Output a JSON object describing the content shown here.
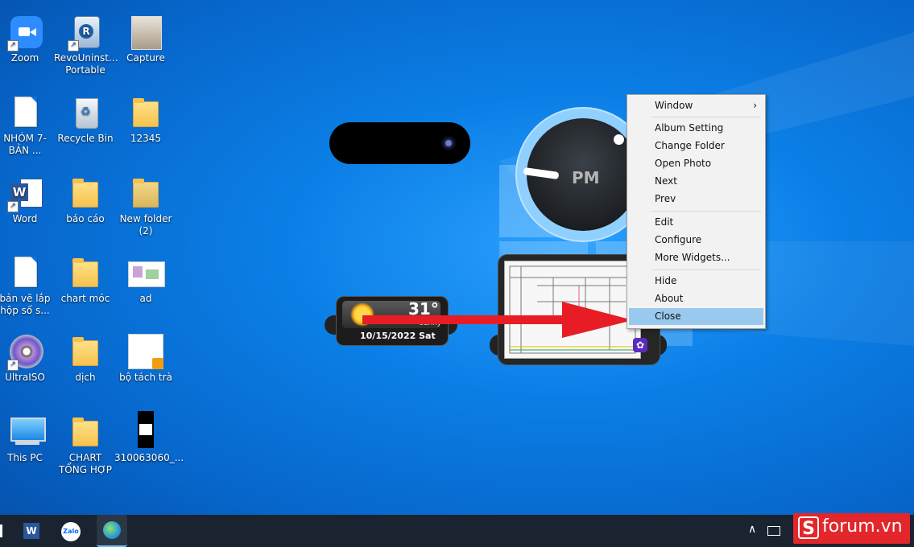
{
  "desktop": {
    "icons": [
      {
        "label": "Zoom"
      },
      {
        "label": "RevoUninst… Portable"
      },
      {
        "label": "Capture"
      },
      {
        "label": "NHÓM 7-BẢN ..."
      },
      {
        "label": "Recycle Bin"
      },
      {
        "label": "12345"
      },
      {
        "label": "Word"
      },
      {
        "label": "báo cáo"
      },
      {
        "label": "New folder (2)"
      },
      {
        "label": "bản vẽ lắp hộp số s..."
      },
      {
        "label": "chart móc"
      },
      {
        "label": "ad"
      },
      {
        "label": "UltraISO"
      },
      {
        "label": "dịch"
      },
      {
        "label": "bộ tách trà"
      },
      {
        "label": "This PC"
      },
      {
        "label": "CHART TỔNG HỢP"
      },
      {
        "label": "310063060_..."
      }
    ]
  },
  "widgets": {
    "clock": {
      "period": "PM"
    },
    "weather": {
      "temperature": "31°",
      "condition": "sunny",
      "date": "10/15/2022 Sat"
    }
  },
  "context_menu": {
    "items": [
      {
        "label": "Window",
        "submenu_marker": "›"
      },
      {
        "label": "Album Setting"
      },
      {
        "label": "Change Folder"
      },
      {
        "label": "Open Photo"
      },
      {
        "label": "Next"
      },
      {
        "label": "Prev"
      },
      {
        "label": "Edit"
      },
      {
        "label": "Configure"
      },
      {
        "label": "More Widgets..."
      },
      {
        "label": "Hide"
      },
      {
        "label": "About"
      },
      {
        "label": "Close"
      }
    ],
    "highlighted": "Close"
  },
  "taskbar": {
    "tray_chevron": "∧",
    "watermark": "forum.vn",
    "watermark_logo": "S"
  },
  "colors": {
    "menu_highlight": "#99c9ef",
    "annotation_arrow": "#e81c24",
    "watermark_bg": "#e3262b"
  }
}
